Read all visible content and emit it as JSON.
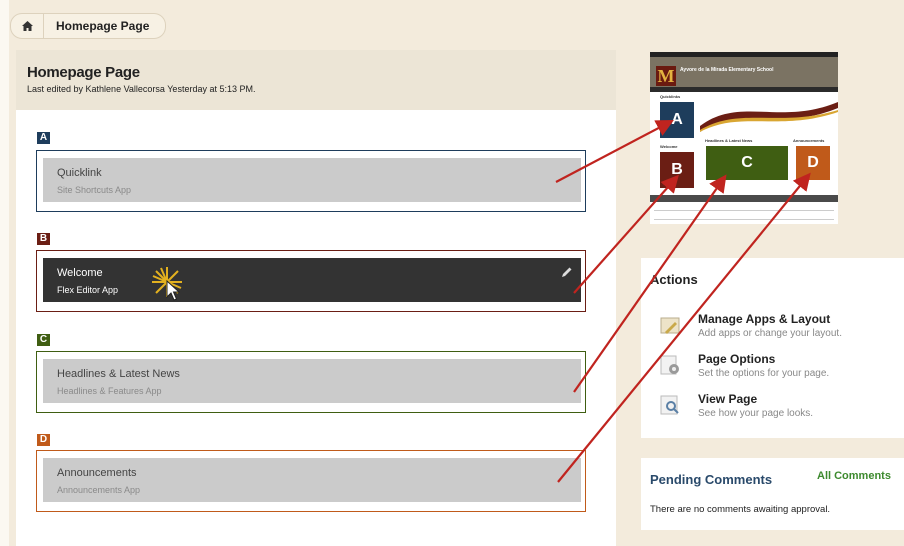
{
  "breadcrumb": {
    "home_icon": "home-icon",
    "page": "Homepage Page"
  },
  "header": {
    "title": "Homepage Page",
    "last_edited": "Last edited by Kathlene Vallecorsa Yesterday at 5:13 PM."
  },
  "regions": [
    {
      "tag": "A",
      "color": "#1e3d5c",
      "app_title": "Quicklink",
      "app_subtitle": "Site Shortcuts App"
    },
    {
      "tag": "B",
      "color": "#6b1e14",
      "app_title": "Welcome",
      "app_subtitle": "Flex Editor App"
    },
    {
      "tag": "C",
      "color": "#3f5e12",
      "app_title": "Headlines & Latest News",
      "app_subtitle": "Headlines & Features App"
    },
    {
      "tag": "D",
      "color": "#c05a1a",
      "app_title": "Announcements",
      "app_subtitle": "Announcements App"
    }
  ],
  "thumbnail": {
    "school_name": "Ayvore de la Mirada Elementary School",
    "logo": "M",
    "labels": {
      "quicklinks": "Quicklinks",
      "welcome": "Welcome",
      "headlines": "Headlines & Latest News",
      "announcements": "Announcements"
    },
    "boxes": [
      "A",
      "B",
      "C",
      "D"
    ]
  },
  "actions": {
    "title": "Actions",
    "items": [
      {
        "icon": "layout-edit-icon",
        "title": "Manage Apps & Layout",
        "description": "Add apps or change your layout."
      },
      {
        "icon": "gear-icon",
        "title": "Page Options",
        "description": "Set the options for your page."
      },
      {
        "icon": "magnifier-icon",
        "title": "View Page",
        "description": "See how your page looks."
      }
    ]
  },
  "pending_comments": {
    "title": "Pending Comments",
    "link": "All Comments",
    "message": "There are no comments awaiting approval."
  },
  "colors": {
    "arrow": "#c0241f",
    "edit_bar": "#333333",
    "accent_green": "#3d8a2e"
  }
}
